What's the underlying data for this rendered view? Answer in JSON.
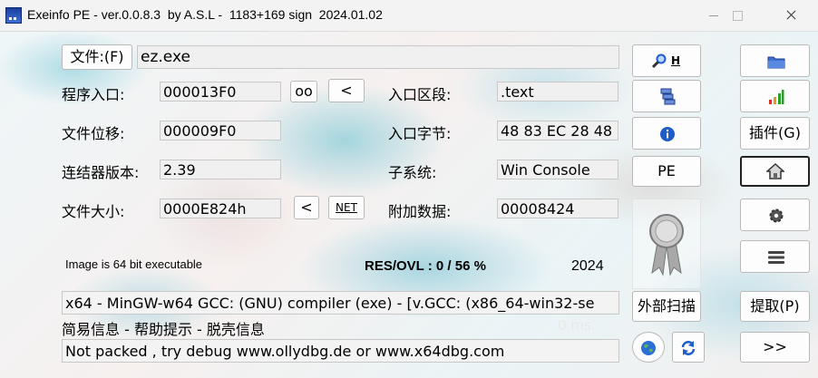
{
  "window": {
    "title": "Exeinfo PE - ver.0.0.8.3  by A.S.L -  1183+169 sign  2024.01.02"
  },
  "file": {
    "button_label": "文件:(F)",
    "value": "ez.exe"
  },
  "fields": {
    "entry_point_label": "程序入口:",
    "entry_point_value": "000013F0",
    "oo_button": "oo",
    "lt_button": "<",
    "file_offset_label": "文件位移:",
    "file_offset_value": "000009F0",
    "linker_label": "连结器版本:",
    "linker_value": "2.39",
    "file_size_label": "文件大小:",
    "file_size_value": "0000E824h",
    "size_lt_button": "<",
    "net_button": "NET",
    "ep_section_label": "入口区段:",
    "ep_section_value": ".text",
    "ep_bytes_label": "入口字节:",
    "ep_bytes_value": "48 83 EC 28 48",
    "subsystem_label": "子系统:",
    "subsystem_value": "Win Console",
    "overlay_label": "附加数据:",
    "overlay_value": "00008424"
  },
  "status": {
    "bit_info": "Image is 64 bit executable",
    "res_ovl": "RES/OVL : 0 / 56 %",
    "year": "2024",
    "detection": " x64 - MinGW-w64 GCC: (GNU) compiler (exe) - [v.GCC: (x86_64-win32-se",
    "links": "简易信息 - 帮助提示 - 脱壳信息",
    "time": "0 ms.",
    "hint": "Not packed , try debug www.ollydbg.de or www.x64dbg.com"
  },
  "right_panel": {
    "pe_button": "PE",
    "ext_scan_button": "外部扫描",
    "plugins_button": "插件(G)",
    "extract_button": "提取(P)",
    "next_button": ">>",
    "search_h_label": "H"
  },
  "icons": {
    "search": "magnifier-icon",
    "sections": "sections-list-icon",
    "info": "info-icon",
    "award": "award-ribbon-icon",
    "globe": "globe-icon",
    "refresh": "refresh-icon",
    "folder": "folder-icon",
    "signal": "signal-bars-icon",
    "home": "home-icon",
    "gear": "gear-icon",
    "menu": "menu-icon"
  },
  "colors": {
    "accent_blue": "#1e5cc8",
    "signal_green": "#2a9d2a",
    "signal_orange": "#e89a20",
    "signal_red": "#d8322b"
  }
}
